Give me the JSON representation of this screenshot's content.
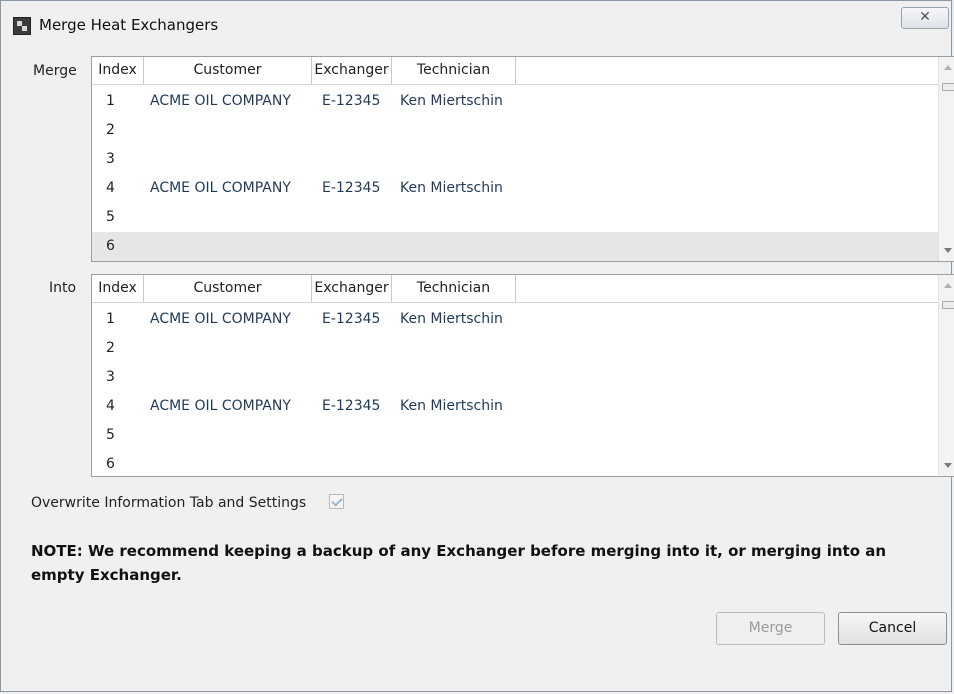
{
  "window": {
    "title": "Merge Heat Exchangers",
    "close_glyph": "✕"
  },
  "icons": {
    "app": "app-icon",
    "close": "close-icon",
    "scroll_up": "scroll-up-arrow-icon",
    "scroll_down": "scroll-down-arrow-icon"
  },
  "merge_section": {
    "label": "Merge",
    "columns": [
      "Index",
      "Customer",
      "Exchanger",
      "Technician"
    ],
    "rows": [
      {
        "index": "1",
        "customer": "ACME OIL COMPANY",
        "exchanger": "E-12345",
        "technician": "Ken Miertschin"
      },
      {
        "index": "2",
        "customer": "",
        "exchanger": "",
        "technician": ""
      },
      {
        "index": "3",
        "customer": "",
        "exchanger": "",
        "technician": ""
      },
      {
        "index": "4",
        "customer": "ACME OIL COMPANY",
        "exchanger": "E-12345",
        "technician": "Ken Miertschin"
      },
      {
        "index": "5",
        "customer": "",
        "exchanger": "",
        "technician": ""
      },
      {
        "index": "6",
        "customer": "",
        "exchanger": "",
        "technician": ""
      }
    ],
    "selected_row": "6"
  },
  "into_section": {
    "label": "Into",
    "columns": [
      "Index",
      "Customer",
      "Exchanger",
      "Technician"
    ],
    "rows": [
      {
        "index": "1",
        "customer": "ACME OIL COMPANY",
        "exchanger": "E-12345",
        "technician": "Ken Miertschin"
      },
      {
        "index": "2",
        "customer": "",
        "exchanger": "",
        "technician": ""
      },
      {
        "index": "3",
        "customer": "",
        "exchanger": "",
        "technician": ""
      },
      {
        "index": "4",
        "customer": "ACME OIL COMPANY",
        "exchanger": "E-12345",
        "technician": "Ken Miertschin"
      },
      {
        "index": "5",
        "customer": "",
        "exchanger": "",
        "technician": ""
      },
      {
        "index": "6",
        "customer": "",
        "exchanger": "",
        "technician": ""
      }
    ]
  },
  "options": {
    "overwrite_label": "Overwrite Information Tab and Settings",
    "overwrite_checked": true
  },
  "note": "NOTE: We recommend keeping a backup of any Exchanger before merging into it, or merging into an empty Exchanger.",
  "buttons": {
    "merge": "Merge",
    "cancel": "Cancel"
  }
}
